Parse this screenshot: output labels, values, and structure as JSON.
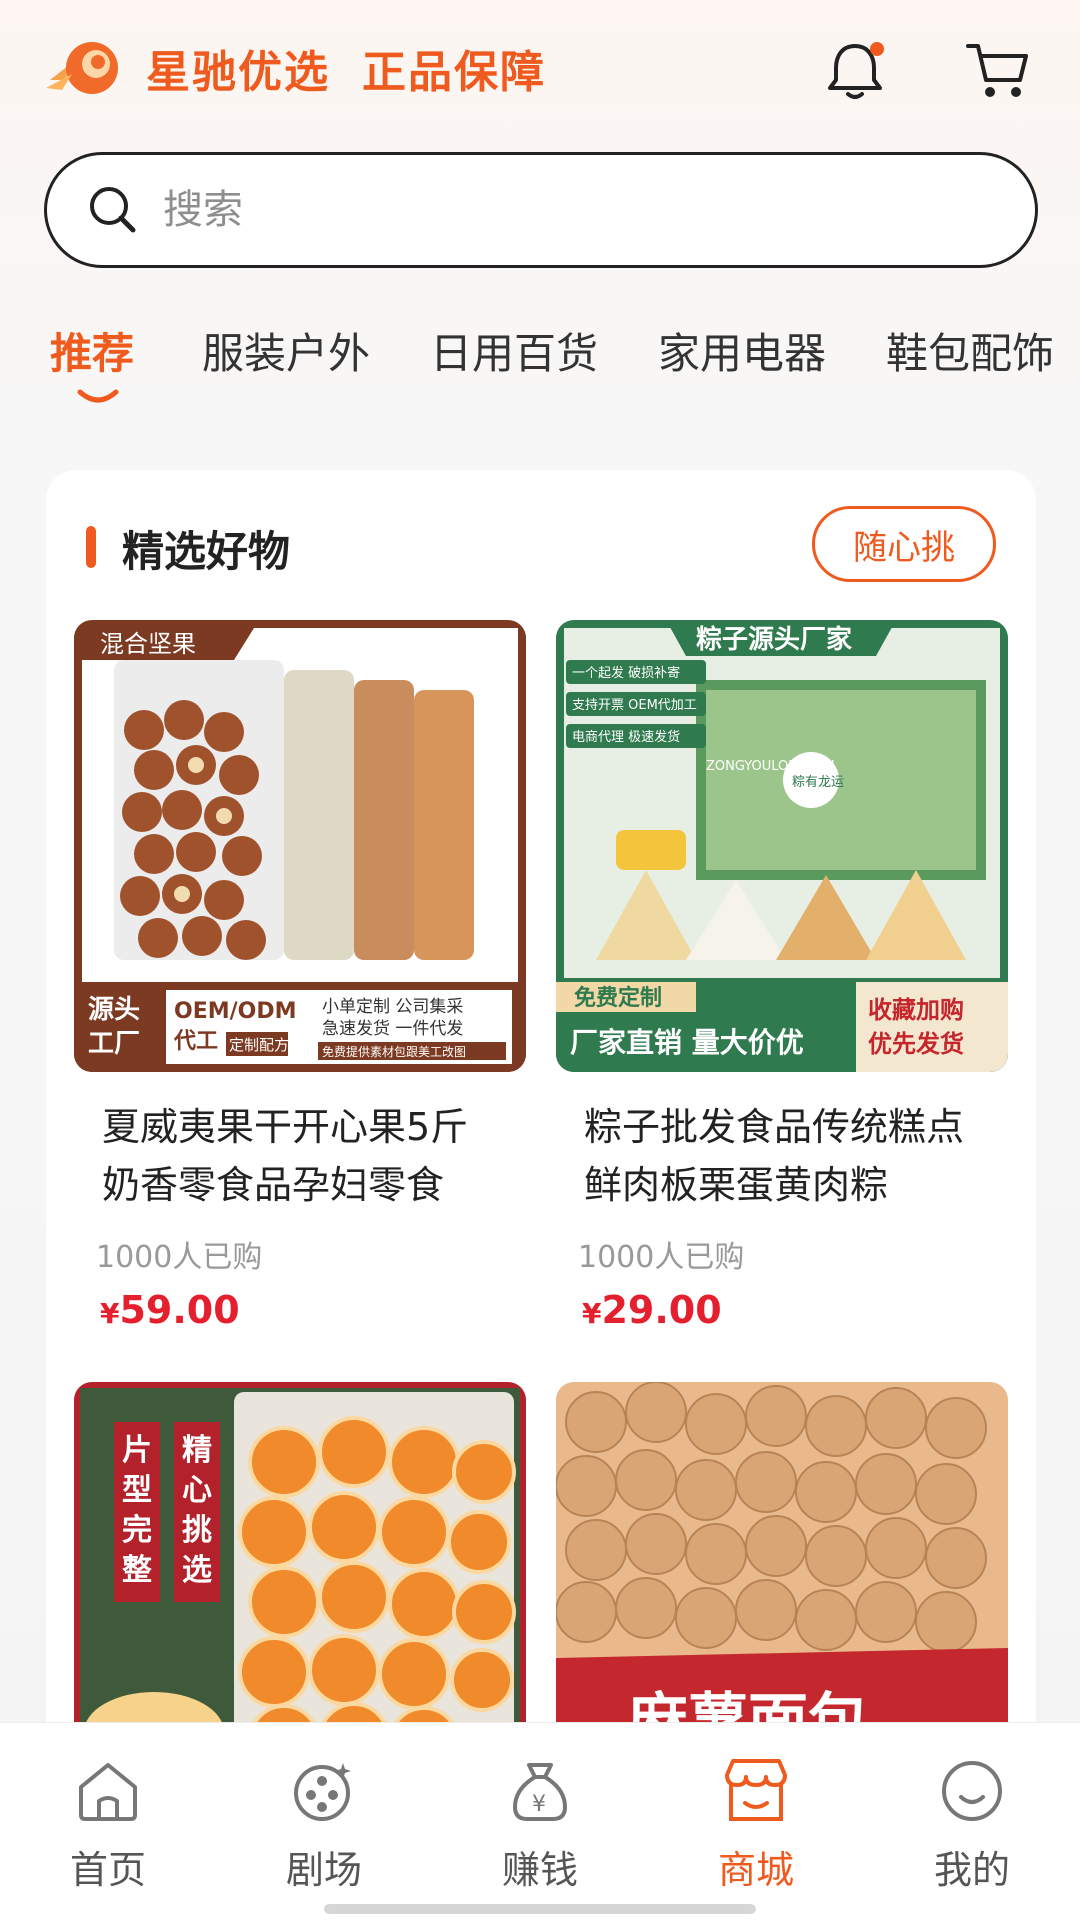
{
  "header": {
    "brand_name": "星驰优选",
    "brand_tag": "正品保障"
  },
  "search": {
    "placeholder": "搜索"
  },
  "categories": [
    "推荐",
    "服装户外",
    "日用百货",
    "家用电器",
    "鞋包配饰"
  ],
  "section": {
    "title": "精选好物",
    "action": "随心挑"
  },
  "products": [
    {
      "title": "夏威夷果干开心果5斤奶香零食品孕妇零食",
      "sold": "1000人已购",
      "currency": "¥",
      "price": "59.00",
      "img_labels": {
        "corner": "混合坚果",
        "side": "源头\n工厂",
        "oem": "OEM/ODM",
        "oem2": "代工",
        "oem3": "定制配方",
        "line1": "小单定制  公司集采",
        "line2": "急速发货  一件代发",
        "line3": "免费提供素材包跟美工改图"
      }
    },
    {
      "title": "粽子批发食品传统糕点鲜肉板栗蛋黄肉粽",
      "sold": "1000人已购",
      "currency": "¥",
      "price": "29.00",
      "img_labels": {
        "top": "粽子源头厂家",
        "tag1": "一个起发 破损补寄",
        "tag2": "支持开票 OEM代加工",
        "tag3": "电商代理 极速发货",
        "free": "免费定制",
        "bottom": "厂家直销 量大价优",
        "fav1": "收藏加购",
        "fav2": "优先发货",
        "box1": "ZONGYOULONGYUN",
        "box2": "粽有龙运"
      }
    },
    {
      "img_labels": {
        "v1": "片型完整",
        "v2": "精心挑选"
      }
    },
    {
      "img_labels": {
        "banner": "麻薯面包"
      }
    }
  ],
  "tabbar": [
    {
      "label": "首页",
      "icon": "home-icon"
    },
    {
      "label": "剧场",
      "icon": "film-reel-icon"
    },
    {
      "label": "赚钱",
      "icon": "money-bag-icon"
    },
    {
      "label": "商城",
      "icon": "store-icon"
    },
    {
      "label": "我的",
      "icon": "profile-icon"
    }
  ],
  "colors": {
    "accent": "#ef5a1f",
    "price": "#e5202e",
    "active_tab": "#ef5a1f"
  }
}
